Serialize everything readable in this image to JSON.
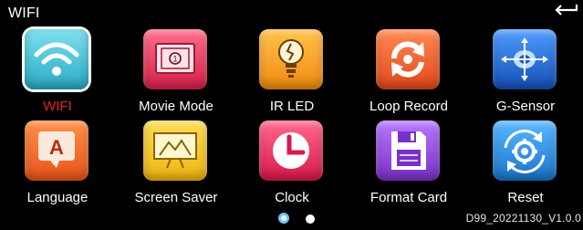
{
  "header": {
    "title": "WIFI"
  },
  "menu": [
    {
      "label": "WIFI",
      "icon": "wifi-icon",
      "color": "#3ec4d8",
      "selected": true
    },
    {
      "label": "Movie Mode",
      "icon": "movie-mode-icon",
      "color": "#e8325a"
    },
    {
      "label": "IR LED",
      "icon": "lightbulb-icon",
      "color": "#f5a21e"
    },
    {
      "label": "Loop Record",
      "icon": "loop-record-icon",
      "color": "#f06a2a"
    },
    {
      "label": "G-Sensor",
      "icon": "gsensor-icon",
      "color": "#2a6fd8"
    },
    {
      "label": "Language",
      "icon": "language-icon",
      "color": "#f07a2a"
    },
    {
      "label": "Screen Saver",
      "icon": "screen-saver-icon",
      "color": "#f2c41e"
    },
    {
      "label": "Clock",
      "icon": "clock-icon",
      "color": "#ec2f62"
    },
    {
      "label": "Format Card",
      "icon": "floppy-disk-icon",
      "color": "#9b4fd8"
    },
    {
      "label": "Reset",
      "icon": "reset-icon",
      "color": "#2a8fe0"
    }
  ],
  "pagination": {
    "current": 1,
    "total": 2
  },
  "version": "D99_20221130_V1.0.0"
}
